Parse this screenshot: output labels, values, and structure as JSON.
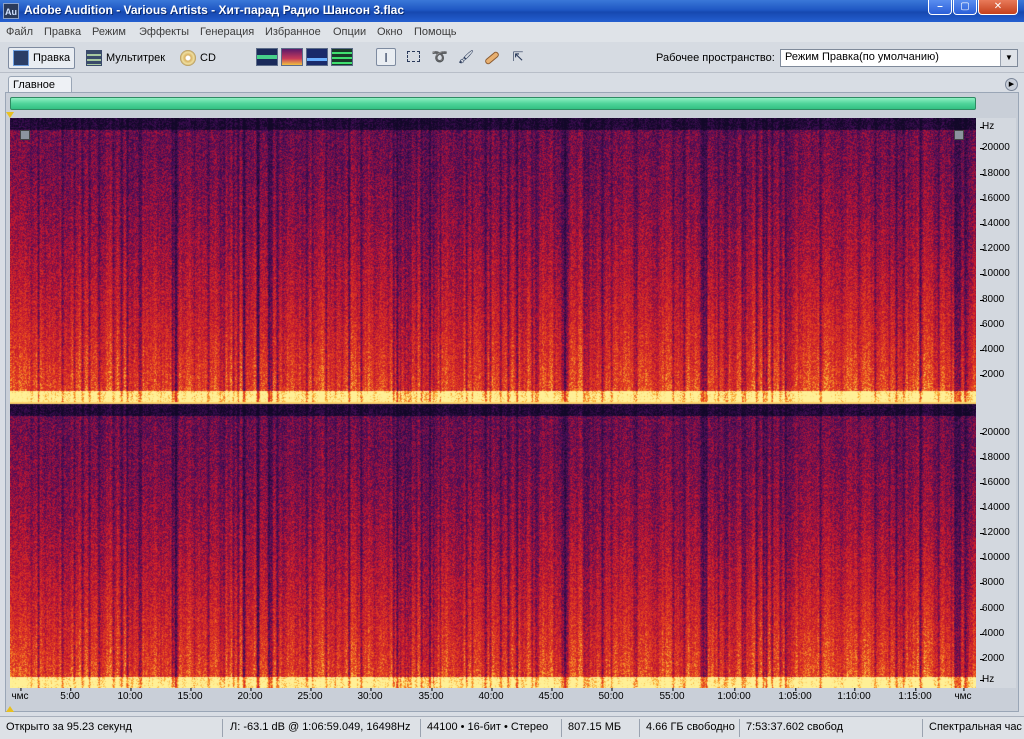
{
  "window": {
    "app_icon": "Au",
    "title": "Adobe Audition - Various Artists - Хит-парад Радио Шансон 3.flac",
    "minimize": "–",
    "maximize": "▢",
    "close": "✕"
  },
  "menu": [
    "Файл",
    "Правка",
    "Режим",
    "Эффекты",
    "Генерация",
    "Избранное",
    "Опции",
    "Окно",
    "Помощь"
  ],
  "toolbar": {
    "edit_label": "Правка",
    "multitrack_label": "Мультитрек",
    "cd_label": "CD",
    "workspace_label": "Рабочее пространство:",
    "workspace_value": "Режим Правка(по умолчанию)"
  },
  "editor": {
    "tab_label": "Главное",
    "freq_unit": "Hz",
    "freq_ticks": [
      "20000",
      "18000",
      "16000",
      "14000",
      "12000",
      "10000",
      "8000",
      "6000",
      "4000",
      "2000"
    ],
    "time_start": "чмс",
    "time_end": "чмс",
    "time_ticks": [
      "5:00",
      "10:00",
      "15:00",
      "20:00",
      "25:00",
      "30:00",
      "35:00",
      "40:00",
      "45:00",
      "50:00",
      "55:00",
      "1:00:00",
      "1:05:00",
      "1:10:00",
      "1:15:00"
    ]
  },
  "status": {
    "opened": "Открыто за 95.23 секунд",
    "cursor": "Л: -63.1 dB @ 1:06:59.049, 16498Hz",
    "format": "44100 • 16-бит • Стерео",
    "size": "807.15 МБ",
    "free": "4.66 ГБ свободно",
    "free_time": "7:53:37.602 свобод",
    "view": "Спектральная час"
  },
  "colors": {
    "title_bar": "#1f57c3",
    "overview": "#4fd49a"
  }
}
